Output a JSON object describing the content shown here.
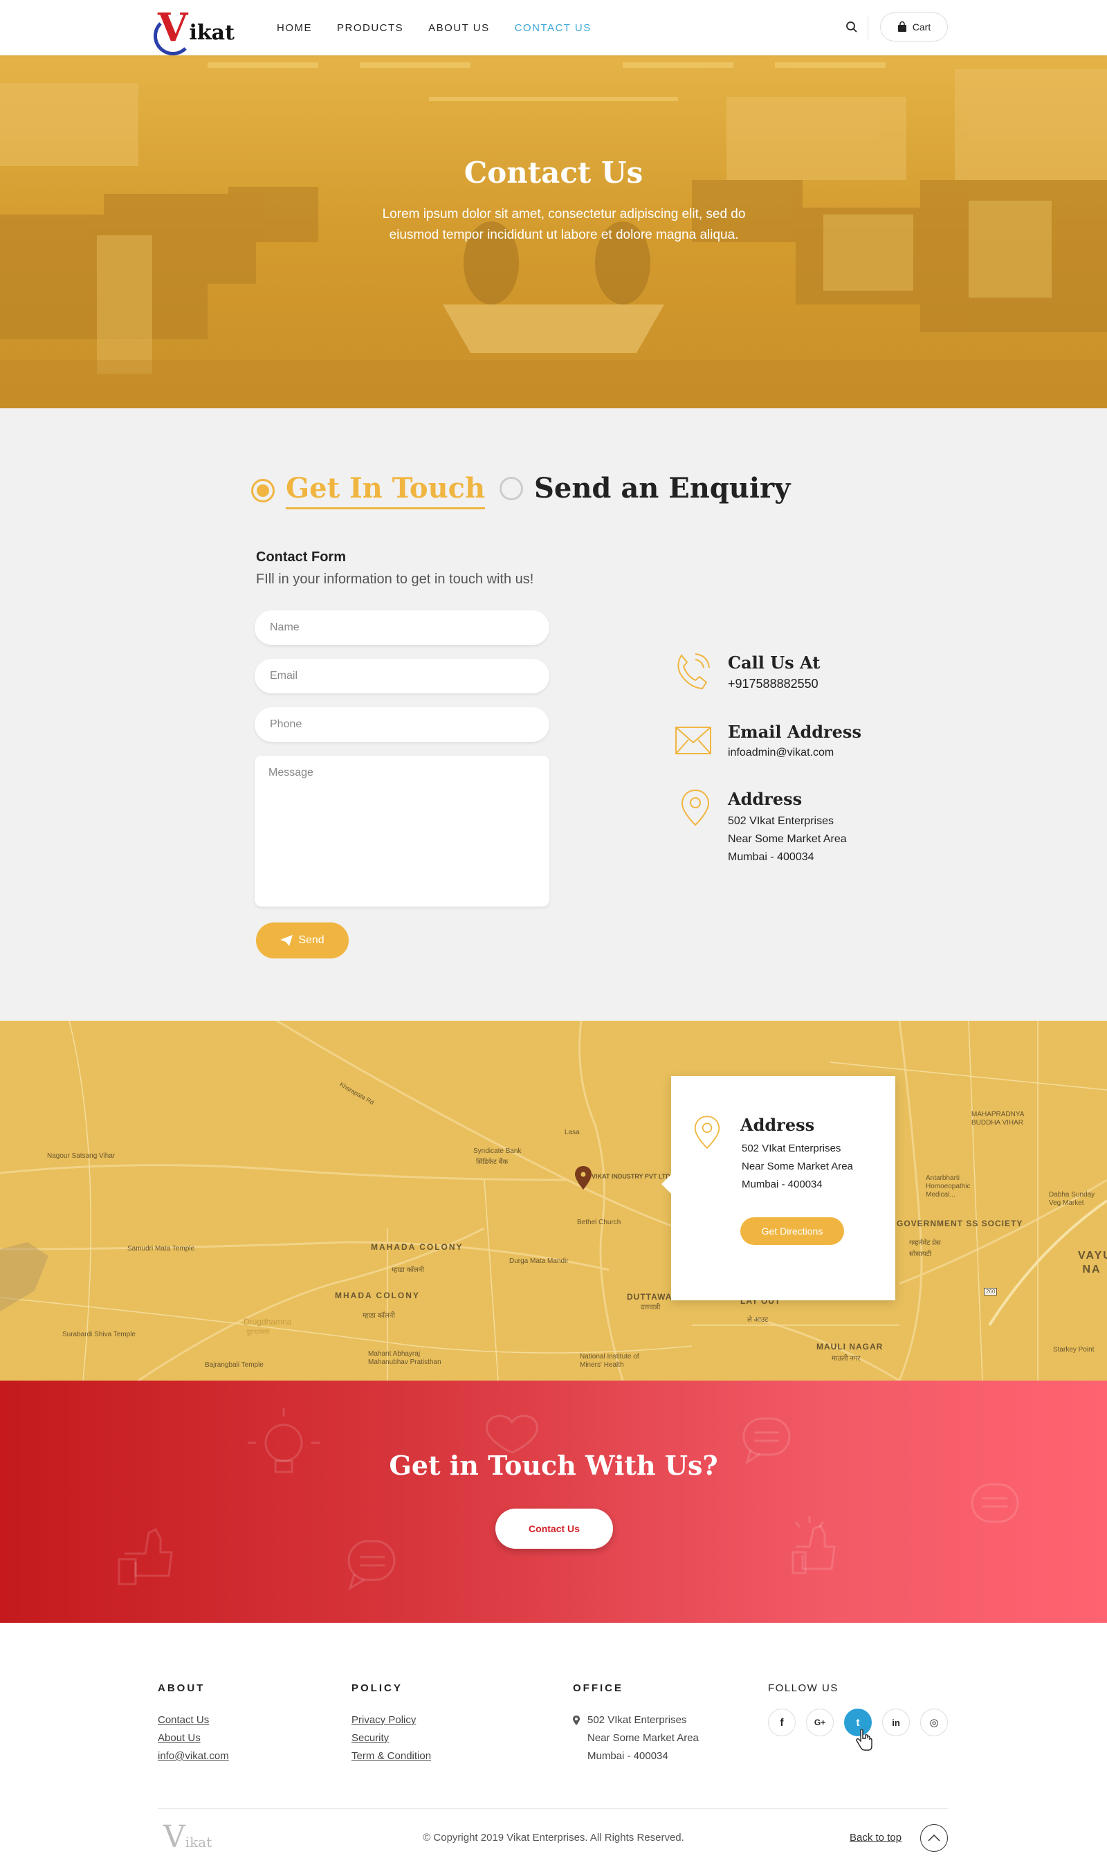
{
  "header": {
    "logo_initial": "V",
    "logo_text": "ikat",
    "nav": [
      "HOME",
      "PRODUCTS",
      "ABOUT US",
      "CONTACT US"
    ],
    "active_nav": "CONTACT US",
    "cart_label": "Cart"
  },
  "hero": {
    "title": "Contact Us",
    "subtitle": "Lorem ipsum dolor sit amet, consectetur adipiscing elit, sed do eiusmod tempor incididunt ut labore et dolore magna aliqua."
  },
  "tabs": {
    "get_in_touch": "Get In Touch",
    "send_enquiry": "Send an Enquiry"
  },
  "form": {
    "title": "Contact Form",
    "subtitle": "FIll in your information to get in touch with us!",
    "name_placeholder": "Name",
    "email_placeholder": "Email",
    "phone_placeholder": "Phone",
    "message_placeholder": "Message",
    "send_label": "Send"
  },
  "contact_info": {
    "call_title": "Call Us At",
    "phone": "+917588882550",
    "email_title": "Email Address",
    "email": "infoadmin@vikat.com",
    "address_title": "Address",
    "address_lines": [
      "502 VIkat Enterprises",
      "Near Some Market Area",
      "Mumbai - 400034"
    ]
  },
  "map": {
    "labels": {
      "nagour": "Nagour Satsang Vihar",
      "syndicate": "Syndicate Bank",
      "syndicate_local": "सिंडिकेट बैंक",
      "lasa": "Lasa",
      "vikat_marker": "VIKAT INDUSTRY PVT LTD",
      "bethel": "Bethel Church",
      "samudri": "Samudri Mata Temple",
      "mahada1": "MAHADA COLONY",
      "mahada1_local": "म्हाडा कॉलनी",
      "durga": "Durga Mata Mandir",
      "mhada2": "MHADA COLONY",
      "mhada2_local": "म्हाडा कॉलनी",
      "drugdhamna": "Drugdhamna",
      "drugdhamna_local": "दुगधामना",
      "surabardi": "Surabardi Shiva Temple",
      "bajrangbali": "Bajrangbali Temple",
      "mahant": "Mahant Abhayraj Mahanubhav Pratisthan",
      "duttawadi": "DUTTAWADI",
      "duttawadi_local": "दत्तवाडी",
      "layout": "LAY OUT",
      "layout_local": "ले आउट",
      "national": "National Institute of Miners' Health",
      "mauli": "MAULI NAGAR",
      "mauli_local": "माउली नगर",
      "mahapradnya": "MAHAPRADNYA BUDDHA VIHAR",
      "antarbharti": "Antarbharti Homoeopathic Medical...",
      "dabha": "Dabha Sunday Veg Market",
      "govt_society": "GOVERNMENT SS SOCIETY",
      "govt_local": "गव्हर्नमेंट प्रेस सोसायटी",
      "vayu": "VAYU NA",
      "starkey": "Starkey Point",
      "kharapata": "Kharapata Rd",
      "highway": "260"
    },
    "card": {
      "title": "Address",
      "lines": [
        "502 VIkat Enterprises",
        "Near Some Market Area",
        "Mumbai - 400034"
      ],
      "button": "Get Directions"
    }
  },
  "cta": {
    "title": "Get in Touch With Us?",
    "button": "Contact Us"
  },
  "footer": {
    "about_head": "ABOUT",
    "about_links": [
      "Contact Us",
      "About Us",
      "info@vikat.com"
    ],
    "policy_head": "POLICY",
    "policy_links": [
      "Privacy Policy",
      "Security",
      "Term & Condition"
    ],
    "office_head": "OFFICE",
    "office_lines": [
      "502 VIkat Enterprises",
      "Near Some Market Area",
      "Mumbai - 400034"
    ],
    "follow_head": "FOLLOW US",
    "social": [
      "facebook-icon",
      "google-plus-icon",
      "twitter-icon",
      "linkedin-icon",
      "instagram-icon"
    ],
    "social_glyphs": [
      "f",
      "G+",
      "t",
      "in",
      "◎"
    ],
    "copyright": "© Copyright 2019 Vikat Enterprises. All Rights Reserved.",
    "back_to_top": "Back to top",
    "logo_initial": "V",
    "logo_text": "ikat"
  },
  "colors": {
    "accent_yellow": "#f0b540",
    "accent_blue": "#3aa6d8",
    "cta_red": "#c41a1d",
    "cta_pink": "#fe6370",
    "twitter_blue": "#2a9fd6"
  }
}
